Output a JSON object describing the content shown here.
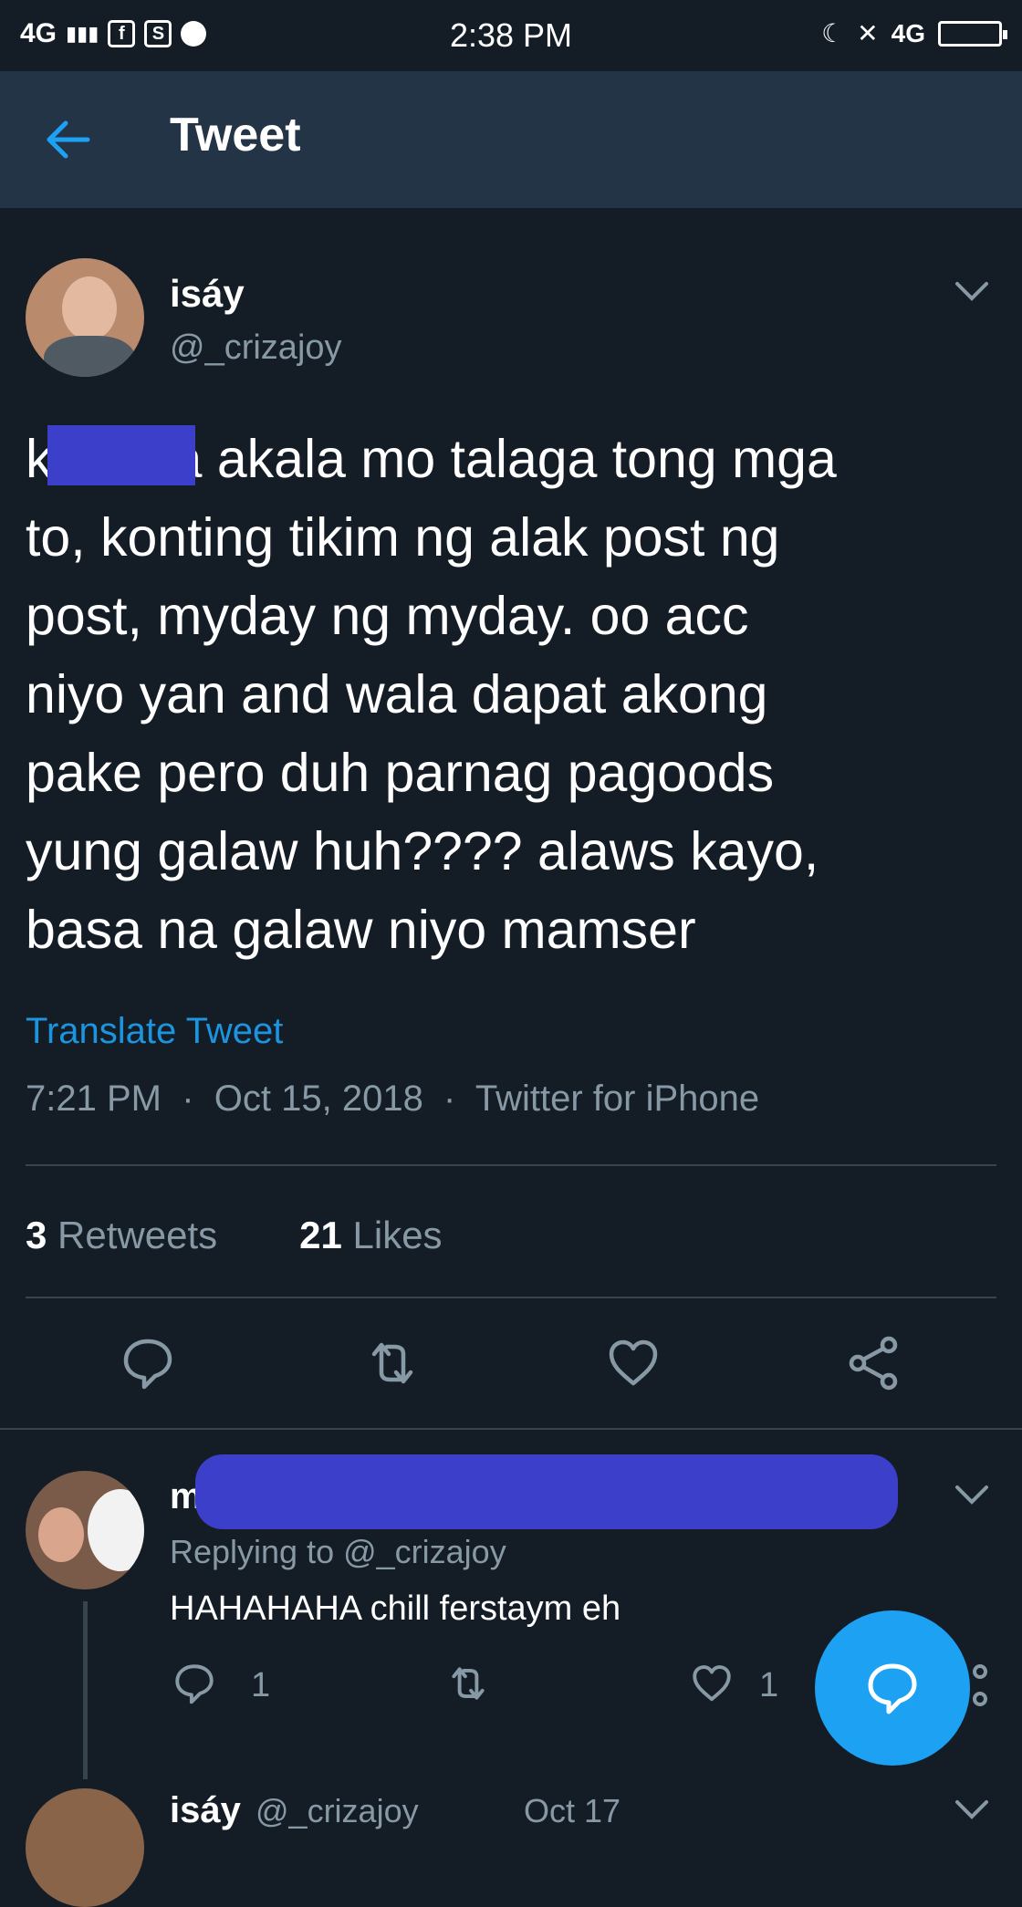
{
  "status_bar": {
    "network_left": "4G",
    "time": "2:38 PM",
    "network_right": "4G"
  },
  "header": {
    "title": "Tweet"
  },
  "tweet": {
    "author_name": "isáy",
    "author_handle": "@_crizajoy",
    "text": "k        a akala mo talaga tong mga\nto, konting tikim ng alak post ng\npost, myday ng myday. oo acc\nniyo yan and wala dapat akong\npake pero duh parnag pagoods\nyung galaw huh???? alaws kayo,\nbasa na galaw niyo mamser",
    "translate_label": "Translate Tweet",
    "time": "7:21 PM",
    "date": "Oct 15, 2018",
    "source": "Twitter for iPhone",
    "retweets_count": "3",
    "retweets_label": "Retweets",
    "likes_count": "21",
    "likes_label": "Likes"
  },
  "reply": {
    "name_visible": "m",
    "replying_to": "Replying to @_crizajoy",
    "text": "HAHAHAHA chill ferstaym eh",
    "reply_count": "1",
    "like_count": "1"
  },
  "next_reply": {
    "name": "isáy",
    "handle": "@_crizajoy",
    "date": "Oct 17"
  },
  "colors": {
    "background": "#141d26",
    "header": "#243447",
    "accent": "#1da1f2",
    "link": "#1b95e0",
    "muted": "#8899a6",
    "redaction": "#3b3fc9"
  },
  "icons": [
    "back-arrow-icon",
    "chevron-down-icon",
    "reply-icon",
    "retweet-icon",
    "heart-icon",
    "share-icon",
    "compose-reply-icon"
  ]
}
